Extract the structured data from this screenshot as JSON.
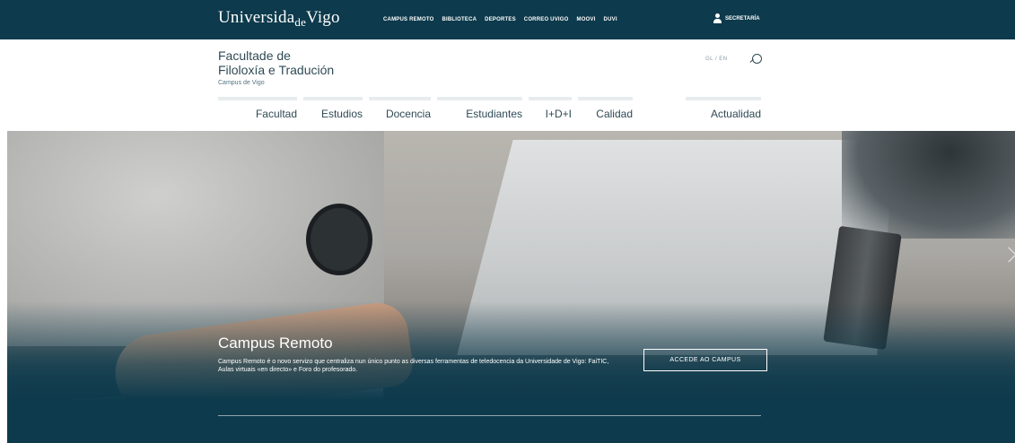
{
  "topbar": {
    "logo_part1": "Universida",
    "logo_part2": "de",
    "logo_part3": "Vigo",
    "links": [
      "CAMPUS REMOTO",
      "BIBLIOTECA",
      "DEPORTES",
      "CORREO UVIGO",
      "MOOVI",
      "DUVI"
    ],
    "secretaria": "SECRETARÍA",
    "user_icon": "user-icon"
  },
  "header": {
    "title_line1": "Facultade de",
    "title_line2": "Filoloxía e Tradución",
    "subtitle": "Campus de Vigo",
    "lang": "GL / EN",
    "search_icon": "search-icon"
  },
  "nav": {
    "items": [
      "Facultad",
      "Estudios",
      "Docencia",
      "Estudiantes",
      "I+D+I",
      "Calidad",
      "Actualidad"
    ]
  },
  "hero": {
    "title": "Campus Remoto",
    "description": "Campus Remoto é o novo servizo que centraliza nun único punto as diversas ferramentas de teledocencia da Universidade de Vigo: FaiTIC, Aulas virtuais «en directo» e Foro do profesorado.",
    "button": "ACCEDE AO CAMPUS",
    "next_icon": "chevron-right-icon"
  },
  "colors": {
    "brand": "#0d3a4c",
    "text": "#2f4a55"
  }
}
